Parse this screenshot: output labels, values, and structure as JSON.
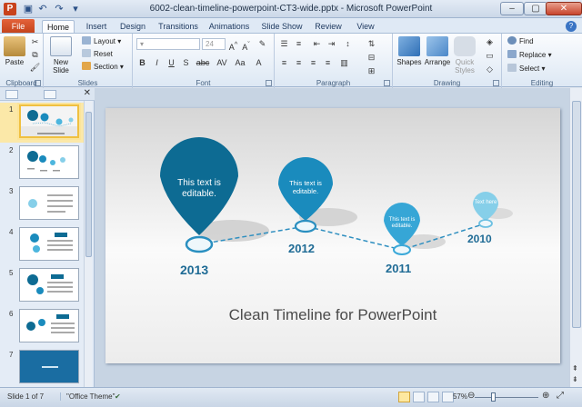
{
  "titlebar": {
    "title": "6002-clean-timeline-powerpoint-CT3-wide.pptx - Microsoft PowerPoint",
    "app_letter": "P"
  },
  "tabs": [
    "File",
    "Home",
    "Insert",
    "Design",
    "Transitions",
    "Animations",
    "Slide Show",
    "Review",
    "View"
  ],
  "active_tab": "Home",
  "ribbon": {
    "clipboard": {
      "label": "Clipboard",
      "paste": "Paste"
    },
    "slides": {
      "label": "Slides",
      "new_slide": "New Slide",
      "layout": "Layout",
      "reset": "Reset",
      "section": "Section"
    },
    "font": {
      "label": "Font",
      "size": "24",
      "buttons": [
        "B",
        "I",
        "U",
        "S",
        "abc",
        "AV",
        "Aa",
        "A"
      ]
    },
    "paragraph": {
      "label": "Paragraph"
    },
    "drawing": {
      "label": "Drawing",
      "shapes": "Shapes",
      "arrange": "Arrange",
      "quick_styles": "Quick Styles"
    },
    "editing": {
      "label": "Editing",
      "find": "Find",
      "replace": "Replace",
      "select": "Select"
    }
  },
  "slides_panel": {
    "numbers": [
      "1",
      "2",
      "3",
      "4",
      "5",
      "6",
      "7"
    ],
    "selected": "1"
  },
  "slide": {
    "title": "Clean Timeline for PowerPoint",
    "bubbles": [
      {
        "text": "This text is editable.",
        "year": "2013"
      },
      {
        "text": "This text is editable.",
        "year": "2012"
      },
      {
        "text": "This text is editable.",
        "year": "2011"
      },
      {
        "text": "Text here",
        "year": "2010"
      }
    ]
  },
  "status": {
    "slide_info": "Slide 1 of 7",
    "theme": "\"Office Theme\"",
    "zoom": "57%"
  },
  "colors": {
    "dark_blue": "#0d6b93",
    "mid_blue": "#1a8bbd",
    "light_blue": "#4db6de",
    "pale_blue": "#86cfe9",
    "file_tab": "#d24a1e"
  }
}
